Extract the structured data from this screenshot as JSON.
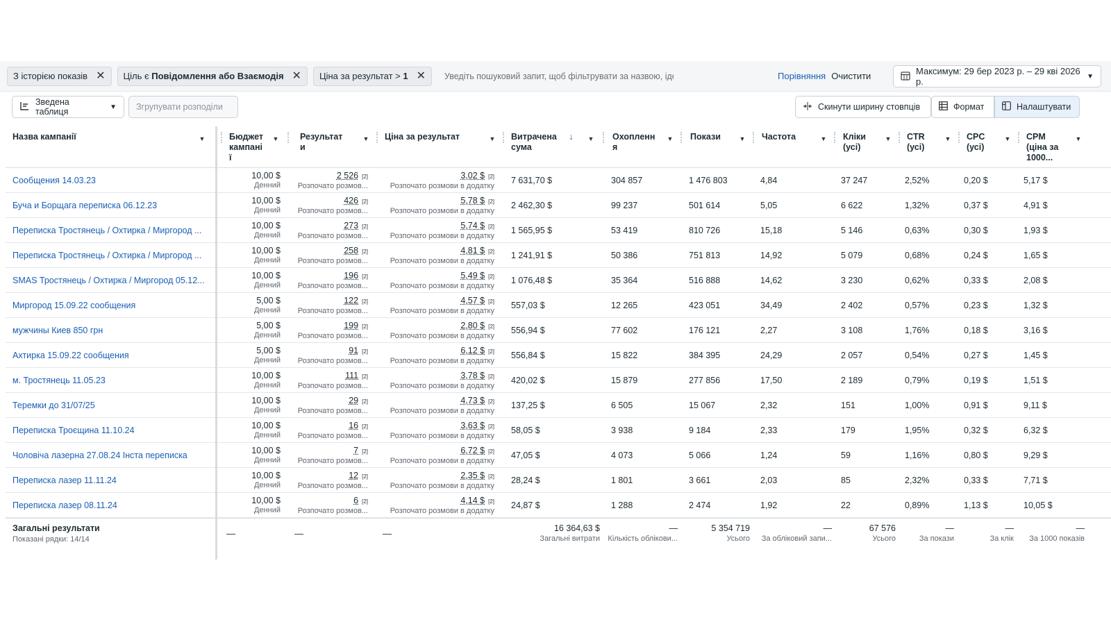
{
  "filters": {
    "chips": [
      {
        "text": "З історією показів",
        "bold": ""
      },
      {
        "text": "Ціль є ",
        "bold": "Повідомлення або Взаємодія"
      },
      {
        "text": "Ціна за результат > ",
        "bold": "1"
      }
    ],
    "search_placeholder": "Уведіть пошуковий запит, щоб фільтрувати за назвою, ідентифікатором або метрикою",
    "compare": "Порівняння",
    "clear": "Очистити",
    "date_range": "Максимум: 29 бер 2023 р. – 29 кві 2026 р."
  },
  "toolbar": {
    "pivot": "Зведена таблиця",
    "group": "Згрупувати розподіли",
    "reset_width": "Скинути ширину стовпців",
    "format": "Формат",
    "customize": "Налаштувати"
  },
  "columns": {
    "name": "Назва кампанії",
    "budget": [
      "Бюджет",
      "кампані",
      "ї"
    ],
    "result": [
      "Результат",
      "и"
    ],
    "cpr": "Ціна за результат",
    "spent": [
      "Витрачена",
      "сума"
    ],
    "reach": [
      "Охопленн",
      "я"
    ],
    "impressions": "Покази",
    "frequency": "Частота",
    "clicks": [
      "Кліки",
      "(усі)"
    ],
    "ctr": [
      "CTR",
      "(усі)"
    ],
    "cpc": [
      "CPC",
      "(усі)"
    ],
    "cpm": [
      "CPM",
      "(ціна за",
      "1000..."
    ]
  },
  "sort_arrow": "↓",
  "budget_sub": "Денний",
  "result_sub": "Розпочато розмов...",
  "cpr_sub": "Розпочато розмови в додатку",
  "footnote": "[2]",
  "rows": [
    {
      "name": "Сообщения 14.03.23",
      "budget": "10,00 $",
      "result": "2 526",
      "cpr": "3,02 $",
      "spent": "7 631,70 $",
      "reach": "304 857",
      "impr": "1 476 803",
      "freq": "4,84",
      "clicks": "37 247",
      "ctr": "2,52%",
      "cpc": "0,20 $",
      "cpm": "5,17 $"
    },
    {
      "name": "Буча и Борщага переписка 06.12.23",
      "budget": "10,00 $",
      "result": "426",
      "cpr": "5,78 $",
      "spent": "2 462,30 $",
      "reach": "99 237",
      "impr": "501 614",
      "freq": "5,05",
      "clicks": "6 622",
      "ctr": "1,32%",
      "cpc": "0,37 $",
      "cpm": "4,91 $"
    },
    {
      "name": "Переписка Тростянець / Охтирка / Миргород ...",
      "budget": "10,00 $",
      "result": "273",
      "cpr": "5,74 $",
      "spent": "1 565,95 $",
      "reach": "53 419",
      "impr": "810 726",
      "freq": "15,18",
      "clicks": "5 146",
      "ctr": "0,63%",
      "cpc": "0,30 $",
      "cpm": "1,93 $"
    },
    {
      "name": "Переписка Тростянець / Охтирка / Миргород ...",
      "budget": "10,00 $",
      "result": "258",
      "cpr": "4,81 $",
      "spent": "1 241,91 $",
      "reach": "50 386",
      "impr": "751 813",
      "freq": "14,92",
      "clicks": "5 079",
      "ctr": "0,68%",
      "cpc": "0,24 $",
      "cpm": "1,65 $"
    },
    {
      "name": "SMAS Тростянець / Охтирка / Миргород 05.12...",
      "budget": "10,00 $",
      "result": "196",
      "cpr": "5,49 $",
      "spent": "1 076,48 $",
      "reach": "35 364",
      "impr": "516 888",
      "freq": "14,62",
      "clicks": "3 230",
      "ctr": "0,62%",
      "cpc": "0,33 $",
      "cpm": "2,08 $"
    },
    {
      "name": "Миргород 15.09.22 сообщения",
      "budget": "5,00 $",
      "result": "122",
      "cpr": "4,57 $",
      "spent": "557,03 $",
      "reach": "12 265",
      "impr": "423 051",
      "freq": "34,49",
      "clicks": "2 402",
      "ctr": "0,57%",
      "cpc": "0,23 $",
      "cpm": "1,32 $"
    },
    {
      "name": "мужчины Киев 850 грн",
      "budget": "5,00 $",
      "result": "199",
      "cpr": "2,80 $",
      "spent": "556,94 $",
      "reach": "77 602",
      "impr": "176 121",
      "freq": "2,27",
      "clicks": "3 108",
      "ctr": "1,76%",
      "cpc": "0,18 $",
      "cpm": "3,16 $"
    },
    {
      "name": "Ахтирка 15.09.22 сообщения",
      "budget": "5,00 $",
      "result": "91",
      "cpr": "6,12 $",
      "spent": "556,84 $",
      "reach": "15 822",
      "impr": "384 395",
      "freq": "24,29",
      "clicks": "2 057",
      "ctr": "0,54%",
      "cpc": "0,27 $",
      "cpm": "1,45 $"
    },
    {
      "name": "м. Тростянець 11.05.23",
      "budget": "10,00 $",
      "result": "111",
      "cpr": "3,78 $",
      "spent": "420,02 $",
      "reach": "15 879",
      "impr": "277 856",
      "freq": "17,50",
      "clicks": "2 189",
      "ctr": "0,79%",
      "cpc": "0,19 $",
      "cpm": "1,51 $"
    },
    {
      "name": "Теремки до 31/07/25",
      "budget": "10,00 $",
      "result": "29",
      "cpr": "4,73 $",
      "spent": "137,25 $",
      "reach": "6 505",
      "impr": "15 067",
      "freq": "2,32",
      "clicks": "151",
      "ctr": "1,00%",
      "cpc": "0,91 $",
      "cpm": "9,11 $"
    },
    {
      "name": "Переписка Троєщина 11.10.24",
      "budget": "10,00 $",
      "result": "16",
      "cpr": "3,63 $",
      "spent": "58,05 $",
      "reach": "3 938",
      "impr": "9 184",
      "freq": "2,33",
      "clicks": "179",
      "ctr": "1,95%",
      "cpc": "0,32 $",
      "cpm": "6,32 $"
    },
    {
      "name": "Чоловіча лазерна 27.08.24 Інста переписка",
      "budget": "10,00 $",
      "result": "7",
      "cpr": "6,72 $",
      "spent": "47,05 $",
      "reach": "4 073",
      "impr": "5 066",
      "freq": "1,24",
      "clicks": "59",
      "ctr": "1,16%",
      "cpc": "0,80 $",
      "cpm": "9,29 $"
    },
    {
      "name": "Переписка лазер 11.11.24",
      "budget": "10,00 $",
      "result": "12",
      "cpr": "2,35 $",
      "spent": "28,24 $",
      "reach": "1 801",
      "impr": "3 661",
      "freq": "2,03",
      "clicks": "85",
      "ctr": "2,32%",
      "cpc": "0,33 $",
      "cpm": "7,71 $"
    },
    {
      "name": "Переписка лазер 08.11.24",
      "budget": "10,00 $",
      "result": "6",
      "cpr": "4,14 $",
      "spent": "24,87 $",
      "reach": "1 288",
      "impr": "2 474",
      "freq": "1,92",
      "clicks": "22",
      "ctr": "0,89%",
      "cpc": "1,13 $",
      "cpm": "10,05 $"
    }
  ],
  "totals": {
    "title": "Загальні результати",
    "shown": "Показані рядки: 14/14",
    "dash": "—",
    "spent": "16 364,63 $",
    "spent_sub": "Загальні витрати",
    "reach_sub": "Кількість облікови...",
    "impr": "5 354 719",
    "impr_sub": "Усього",
    "freq_sub": "За обліковий запи...",
    "clicks": "67 576",
    "clicks_sub": "Усього",
    "ctr_sub": "За покази",
    "cpc_sub": "За клік",
    "cpm_sub": "За 1000 показів"
  }
}
